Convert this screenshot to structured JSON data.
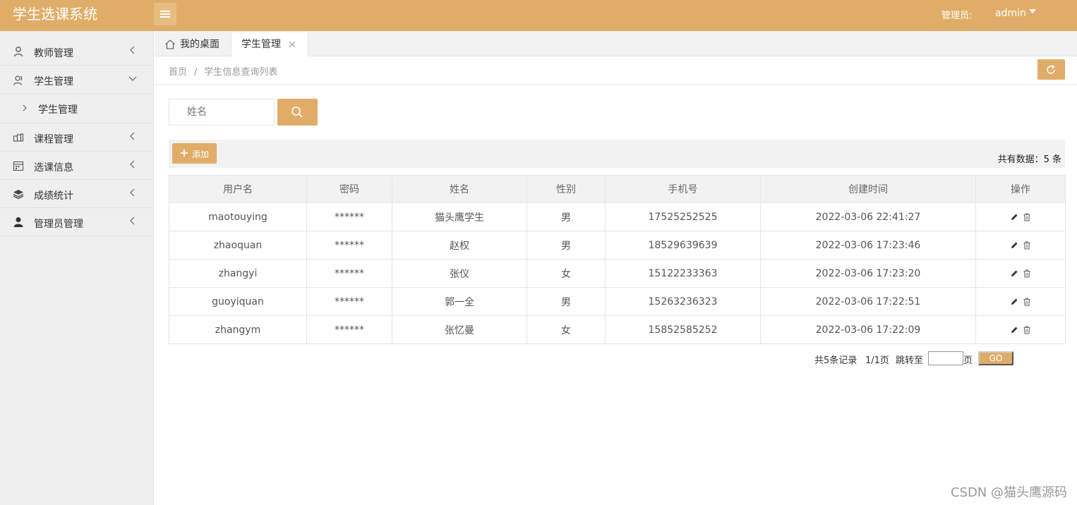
{
  "header": {
    "app_title": "学生选课系统",
    "admin_label": "管理员:",
    "username": "admin"
  },
  "sidebar": {
    "items": [
      {
        "label": "教师管理",
        "icon": "user-icon",
        "expanded": false
      },
      {
        "label": "学生管理",
        "icon": "users-icon",
        "expanded": true
      },
      {
        "label": "课程管理",
        "icon": "course-icon",
        "expanded": false
      },
      {
        "label": "选课信息",
        "icon": "calendar-icon",
        "expanded": false
      },
      {
        "label": "成绩统计",
        "icon": "layers-icon",
        "expanded": false
      },
      {
        "label": "管理员管理",
        "icon": "admin-user-icon",
        "expanded": false
      }
    ],
    "sub_item": {
      "label": "学生管理"
    }
  },
  "tabs": {
    "home": {
      "label": "我的桌面"
    },
    "active": {
      "label": "学生管理"
    }
  },
  "breadcrumb": {
    "home": "首页",
    "separator": "/",
    "current": "学生信息查询列表"
  },
  "search": {
    "placeholder": "姓名"
  },
  "toolbar": {
    "add_label": "添加",
    "total_text": "共有数据：5 条"
  },
  "table": {
    "headers": [
      "用户名",
      "密码",
      "姓名",
      "性别",
      "手机号",
      "创建时间",
      "操作"
    ],
    "rows": [
      [
        "maotouying",
        "******",
        "猫头鹰学生",
        "男",
        "17525252525",
        "2022-03-06 22:41:27"
      ],
      [
        "zhaoquan",
        "******",
        "赵权",
        "男",
        "18529639639",
        "2022-03-06 17:23:46"
      ],
      [
        "zhangyi",
        "******",
        "张仪",
        "女",
        "15122233363",
        "2022-03-06 17:23:20"
      ],
      [
        "guoyiquan",
        "******",
        "郭一全",
        "男",
        "15263236323",
        "2022-03-06 17:22:51"
      ],
      [
        "zhangym",
        "******",
        "张忆曼",
        "女",
        "15852585252",
        "2022-03-06 17:22:09"
      ]
    ]
  },
  "pagination": {
    "total_records": "共5条记录",
    "pages": "1/1页",
    "jump_label": "跳转至",
    "page_unit": "页",
    "go_label": "GO",
    "jump_value": ""
  },
  "watermark": "CSDN @猫头鹰源码",
  "colors": {
    "brand": "#e0ad68",
    "sidebar_bg": "#efefef"
  }
}
